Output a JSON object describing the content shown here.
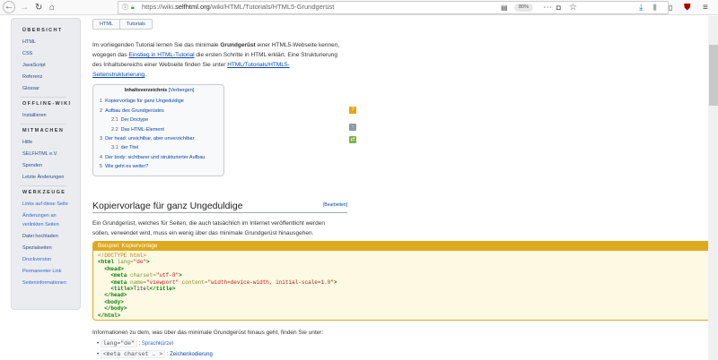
{
  "browser": {
    "url_prefix": "https://wiki.",
    "url_domain": "selfhtml.org",
    "url_path": "/wiki/HTML/Tutorials/HTML5-Grundgerüst",
    "zoom": "80%"
  },
  "breadcrumb": [
    "HTML",
    "Tutorials"
  ],
  "sidebar": {
    "overview_heading": "ÜBERSICHT",
    "overview": [
      "HTML",
      "CSS",
      "JavaScript",
      "Referenz",
      "Glossar"
    ],
    "offline_heading": "OFFLINE-WIKI",
    "offline": [
      "Installieren"
    ],
    "contribute_heading": "MITMACHEN",
    "contribute": [
      "Hilfe",
      "SELFHTML e.V.",
      "Spenden",
      "Letzte Änderungen"
    ],
    "tools_heading": "WERKZEUGE",
    "tools": [
      "Links auf diese Seite",
      "Änderungen an",
      "verlinkten Seiten",
      "Datei hochladen",
      "Spezialseiten",
      "Druckversion",
      "Permanenter Link",
      "Seiteninformationen"
    ]
  },
  "intro": {
    "t1": "Im vorliegenden Tutorial lernen Sie das minimale ",
    "bold": "Grundgerüst",
    "t2": " einer HTML5-Webseite kennen,",
    "t3": "wogegen das ",
    "link1": "Einstieg in HTML-Tutorial",
    "t4": " die ersten Schritte in HTML erklärt. Eine Strukturierung",
    "t5": "des Inhaltsbereichs einer Webseite finden Sie unter ",
    "link2a": "HTML/Tutorials/HTML5-",
    "link2b": "Seitenstrukturierung",
    "t6": "."
  },
  "toc": {
    "title": "Inhaltsverzeichnis",
    "toggle": "[Verbergen]",
    "items": [
      {
        "num": "1",
        "label": "Kopiervorlage für ganz Ungeduldige"
      },
      {
        "num": "2",
        "label": "Aufbau des Grundgerüstes"
      },
      {
        "num": "2.1",
        "label": "Der Doctype"
      },
      {
        "num": "2.2",
        "label": "Das HTML-Element"
      },
      {
        "num": "3",
        "label": "Der head: unsichtbar, aber unverzichtbar"
      },
      {
        "num": "3.1",
        "label": "der Titel"
      },
      {
        "num": "4",
        "label": "Der body: sichtbarer und strukturierter Aufbau"
      },
      {
        "num": "5",
        "label": "Wie geht es weiter?"
      }
    ]
  },
  "section": {
    "heading": "Kopiervorlage für ganz Ungeduldige",
    "edit": "[Bearbeiten]",
    "p1": "Ein Grundgerüst, welches für Seiten, die auch tatsächlich im Internet veröffentlicht werden",
    "p2": "sollen, verwendet wird, muss ein wenig über das minimale Grundgerüst hinausgehen."
  },
  "example": {
    "title": "Beispiel: Kopiervorlage"
  },
  "info": "Informationen zu dem, was über das minimale Grundgerüst hinaus geht, finden Sie unter:",
  "bullets": [
    {
      "code": "lang=\"de\"",
      "sep": " : ",
      "link": "Sprachkürzel"
    },
    {
      "code": "<meta charset … >",
      "sep": " : ",
      "link": "Zeichenkodierung"
    }
  ],
  "colors": {
    "accent": "#dfa91d",
    "link": "#0645ad",
    "sidebar": "#eaecf0"
  }
}
